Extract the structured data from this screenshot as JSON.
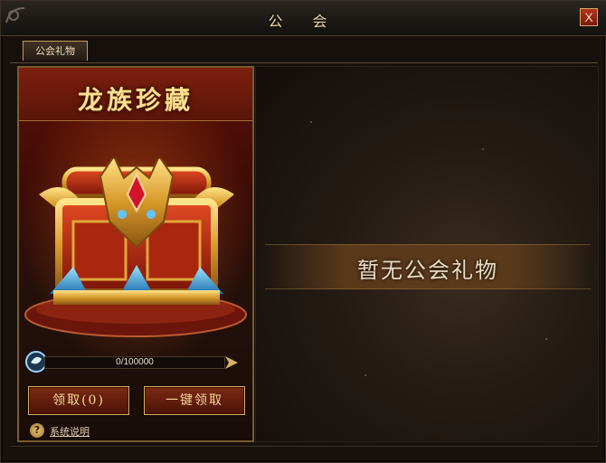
{
  "window": {
    "title": "公 会",
    "close_label": "X"
  },
  "tabs": [
    {
      "label": "公会礼物",
      "active": true
    }
  ],
  "treasure": {
    "title": "龙族珍藏",
    "progress": {
      "text": "0/100000",
      "current": 0,
      "max": 100000
    },
    "buttons": {
      "claim": "领取(0)",
      "claim_all": "一键领取"
    },
    "help_label": "系统说明"
  },
  "gifts": {
    "empty_text": "暂无公会礼物"
  },
  "colors": {
    "gold": "#f6d99a",
    "title_gold": "#fbe08f",
    "button_red": "#7c2a12",
    "panel_red": "#5c1108",
    "gem_blue": "#4ab4f0"
  },
  "icons": [
    "corner-ornament-icon",
    "close-icon",
    "dragon-chest-icon",
    "gem-icon",
    "arrow-right-icon",
    "help-icon"
  ]
}
